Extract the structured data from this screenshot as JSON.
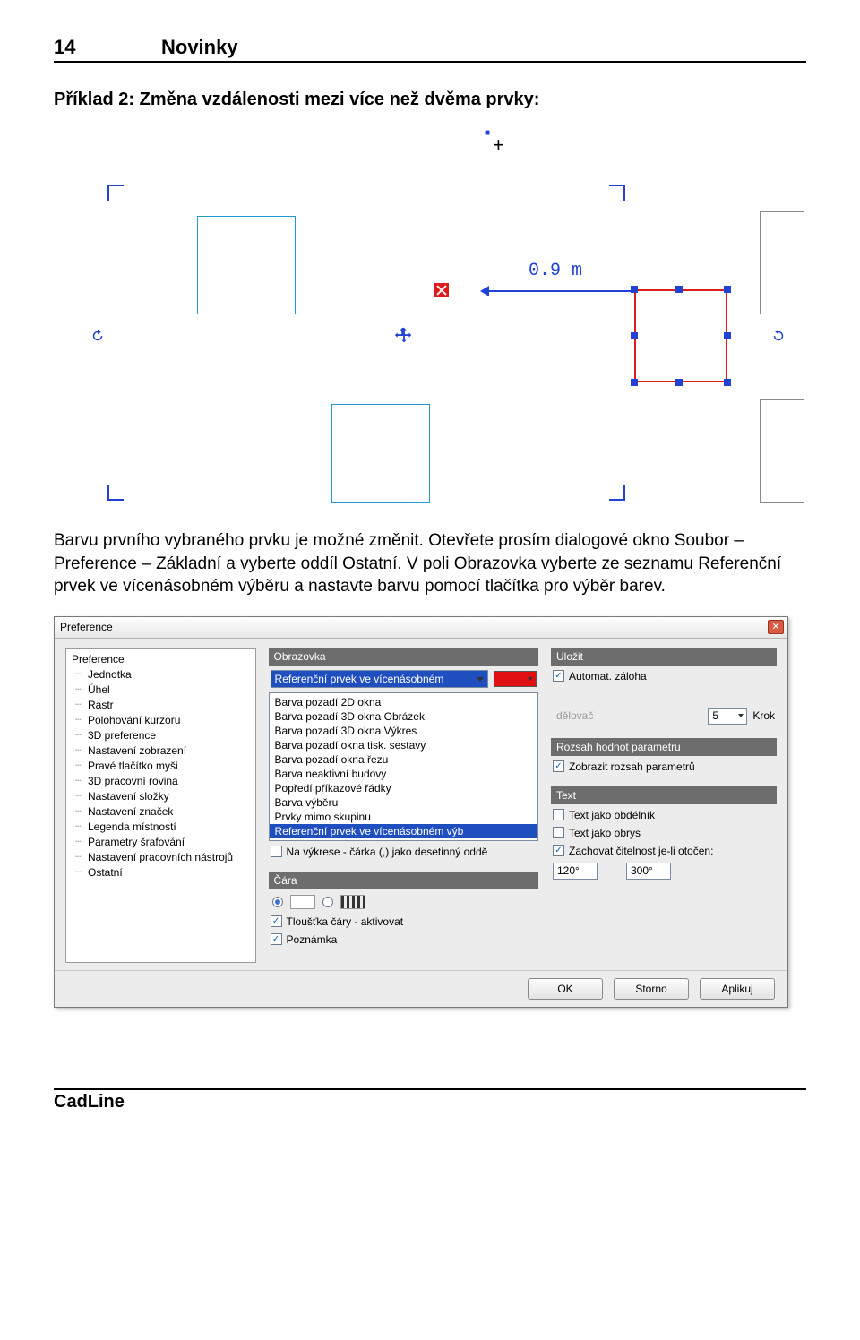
{
  "page": {
    "number": "14",
    "section": "Novinky"
  },
  "example_title": "Příklad 2: Změna vzdálenosti mezi více než dvěma prvky:",
  "cad": {
    "dimension": "0.9 m"
  },
  "paragraph": "Barvu prvního vybraného prvku je možné změnit. Otevřete prosím dialogové okno Soubor – Preference – Základní a vyberte oddíl Ostatní. V poli Obrazovka vyberte ze seznamu Referenční prvek ve vícenásobném výběru a nastavte barvu pomocí tlačítka pro výběr barev.",
  "dialog": {
    "title": "Preference",
    "tree_root": "Preference",
    "tree_items": [
      "Jednotka",
      "Úhel",
      "Rastr",
      "Polohování kurzoru",
      "3D preference",
      "Nastavení zobrazení",
      "Pravé tlačítko myši",
      "3D pracovní rovina",
      "Nastavení složky",
      "Nastavení značek",
      "Legenda místností",
      "Parametry šrafování",
      "Nastavení pracovních nástrojů",
      "Ostatní"
    ],
    "sec_obrazovka": "Obrazovka",
    "combo_selected": "Referenční prvek ve vícenásobném",
    "list_items": [
      "Barva pozadí 2D okna",
      "Barva pozadí 3D okna Obrázek",
      "Barva pozadí 3D okna Výkres",
      "Barva pozadí okna tisk. sestavy",
      "Barva pozadí okna řezu",
      "Barva neaktivní budovy",
      "Popředí příkazové řádky",
      "Barva výběru",
      "Prvky mimo skupinu",
      "Referenční prvek ve vícenásobném výb"
    ],
    "truncated_chk": "Na výkrese - čárka (,) jako desetinný oddě",
    "sec_cara": "Čára",
    "chk_tloustka": "Tloušťka čáry - aktivovat",
    "chk_poznamka": "Poznámka",
    "sec_ulozit": "Uložit",
    "chk_zaloha": "Automat. záloha",
    "krok_value": "5",
    "krok_label": "Krok",
    "delovac_trail": "dělovač",
    "sec_rozsah": "Rozsah hodnot parametru",
    "chk_rozsah": "Zobrazit rozsah parametrů",
    "sec_text": "Text",
    "chk_text_obdelnik": "Text jako obdélník",
    "chk_text_obrys": "Text jako obrys",
    "chk_citel": "Zachovat čitelnost je-li otočen:",
    "angle1": "120°",
    "angle2": "300°",
    "btn_ok": "OK",
    "btn_storno": "Storno",
    "btn_aplikuj": "Aplikuj"
  },
  "footer": "CadLine"
}
